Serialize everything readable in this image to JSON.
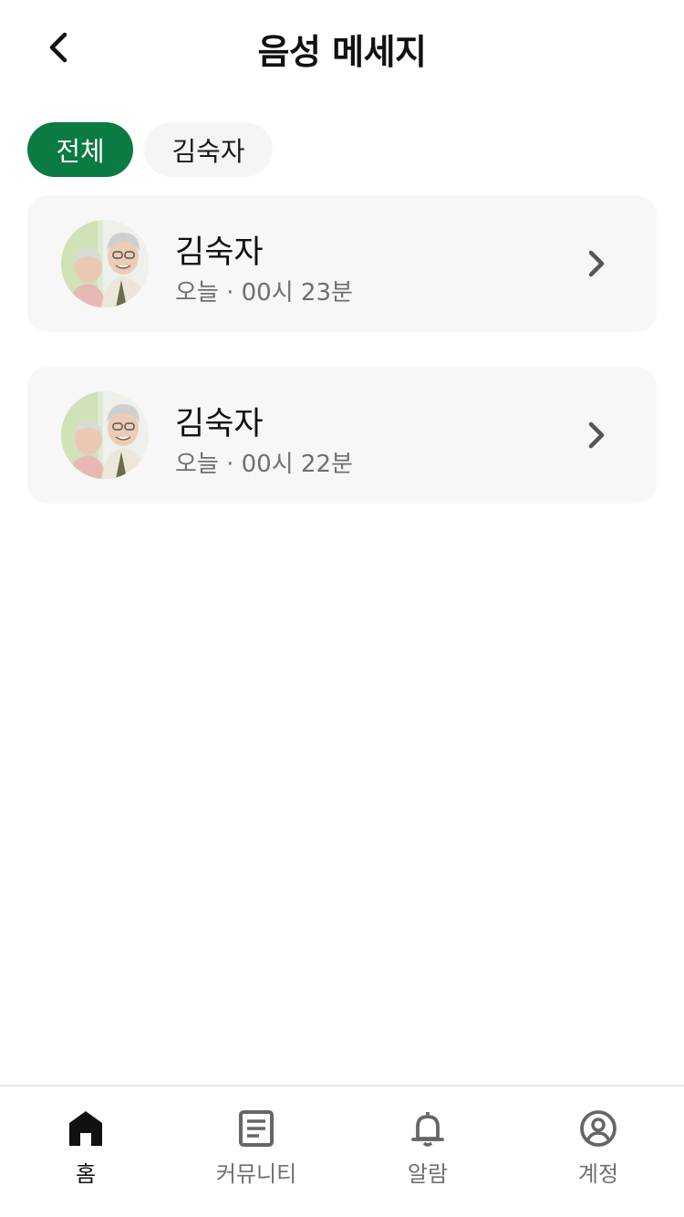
{
  "header": {
    "title": "음성 메세지",
    "back_icon": "chevron-left-icon"
  },
  "filters": [
    {
      "label": "전체",
      "selected": true
    },
    {
      "label": "김숙자",
      "selected": false
    }
  ],
  "messages": [
    {
      "name": "김숙자",
      "meta": "오늘 · 00시 23분",
      "avatar": "elderly-couple-photo"
    },
    {
      "name": "김숙자",
      "meta": "오늘 · 00시 22분",
      "avatar": "elderly-couple-photo"
    }
  ],
  "bottom_nav": [
    {
      "label": "홈",
      "icon": "home-icon",
      "active": true
    },
    {
      "label": "커뮤니티",
      "icon": "document-icon",
      "active": false
    },
    {
      "label": "알람",
      "icon": "bell-icon",
      "active": false
    },
    {
      "label": "계정",
      "icon": "account-icon",
      "active": false
    }
  ],
  "colors": {
    "accent": "#0b7a43",
    "card_bg": "#f7f7f7",
    "chip_bg": "#f5f5f5",
    "muted_text": "#6f6f6f"
  }
}
